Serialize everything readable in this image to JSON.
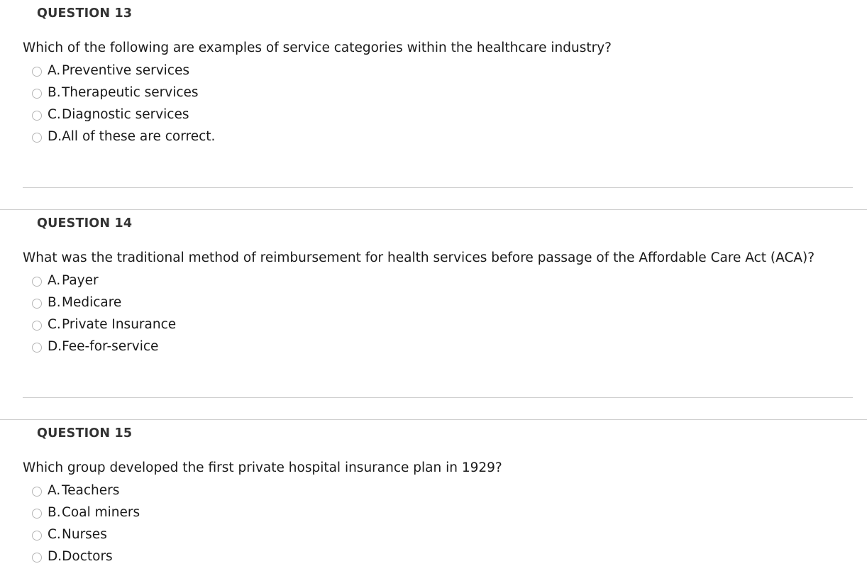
{
  "page": {
    "background_color": "#ffffff",
    "text_color": "#1a1a1a",
    "heading_color": "#333333",
    "rule_color": "#cfcfcf",
    "radio_border_color": "#b6b6b6"
  },
  "questions": [
    {
      "heading": "QUESTION 13",
      "prompt": "Which of the following are examples of service categories within the healthcare industry?",
      "options": [
        {
          "letter": "A.",
          "text": "Preventive services"
        },
        {
          "letter": "B.",
          "text": "Therapeutic services"
        },
        {
          "letter": "C.",
          "text": "Diagnostic services"
        },
        {
          "letter": "D.",
          "text": "All of these are correct."
        }
      ]
    },
    {
      "heading": "QUESTION 14",
      "prompt": "What was the traditional method of reimbursement for health services before passage of the Affordable Care Act (ACA)?",
      "options": [
        {
          "letter": "A.",
          "text": "Payer"
        },
        {
          "letter": "B.",
          "text": "Medicare"
        },
        {
          "letter": "C.",
          "text": "Private Insurance"
        },
        {
          "letter": "D.",
          "text": "Fee-for-service"
        }
      ]
    },
    {
      "heading": "QUESTION 15",
      "prompt": "Which group developed the first private hospital insurance plan in 1929?",
      "options": [
        {
          "letter": "A.",
          "text": "Teachers"
        },
        {
          "letter": "B.",
          "text": "Coal miners"
        },
        {
          "letter": "C.",
          "text": "Nurses"
        },
        {
          "letter": "D.",
          "text": "Doctors"
        }
      ]
    }
  ]
}
